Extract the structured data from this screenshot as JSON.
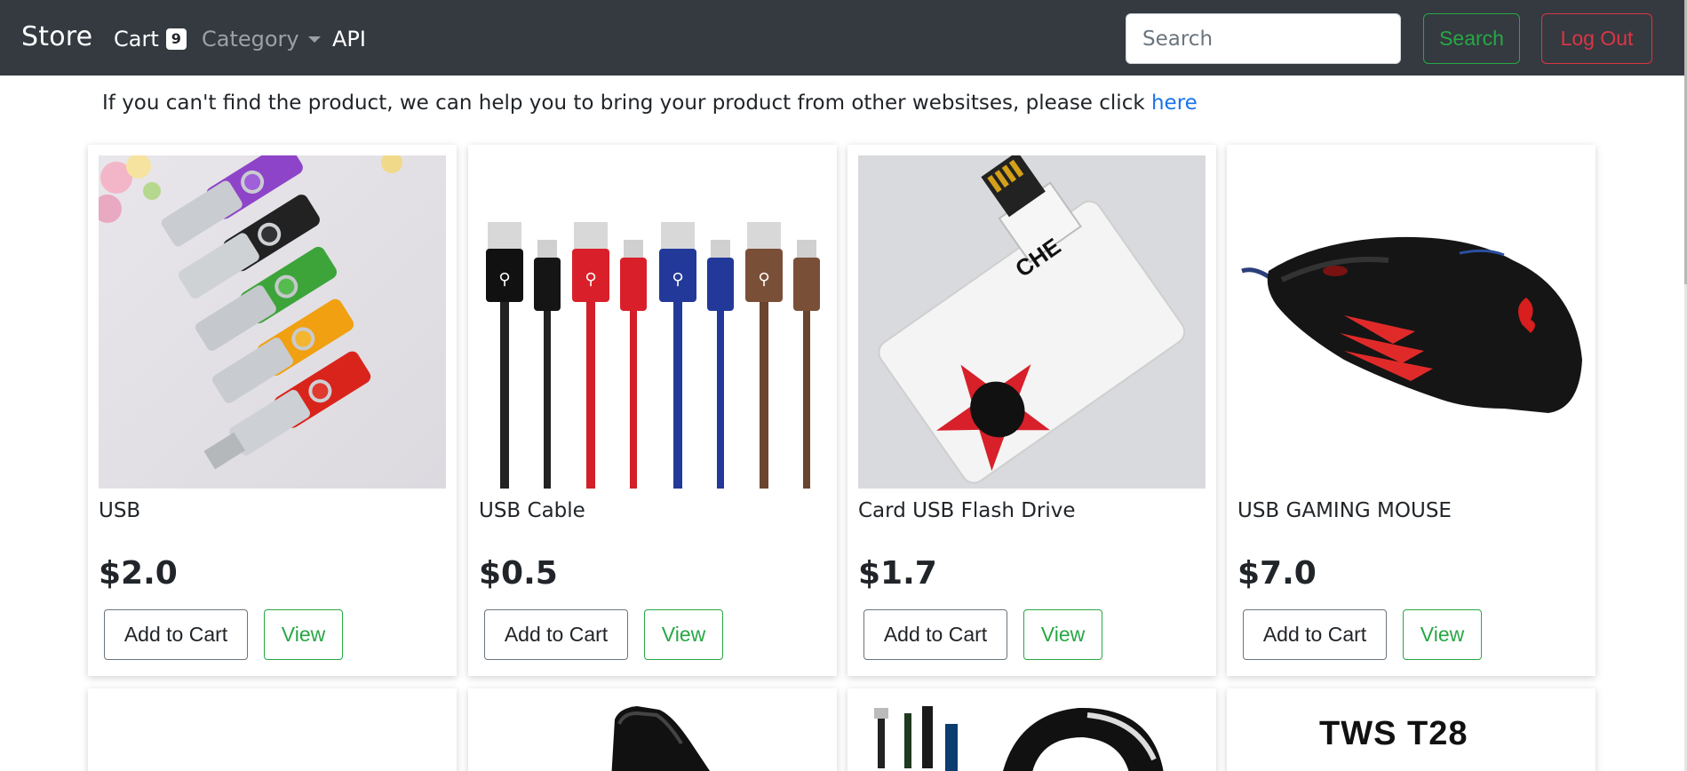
{
  "navbar": {
    "brand": "Store",
    "cart_label": "Cart",
    "cart_count": "9",
    "category_label": "Category",
    "api_label": "API",
    "search_placeholder": "Search",
    "search_button": "Search",
    "logout_button": "Log Out"
  },
  "notice": {
    "text": "If you can't find the product, we can help you to bring your product from other websitses, please click ",
    "link_text": "here"
  },
  "products": [
    {
      "title": "USB",
      "price": "$2.0",
      "add_label": "Add to Cart",
      "view_label": "View",
      "image": "usb-flash-drives-image"
    },
    {
      "title": "USB Cable",
      "price": "$0.5",
      "add_label": "Add to Cart",
      "view_label": "View",
      "image": "usb-cables-image"
    },
    {
      "title": "Card USB Flash Drive",
      "price": "$1.7",
      "add_label": "Add to Cart",
      "view_label": "View",
      "image": "card-flash-drive-image"
    },
    {
      "title": "USB GAMING MOUSE",
      "price": "$7.0",
      "add_label": "Add to Cart",
      "view_label": "View",
      "image": "gaming-mouse-image"
    }
  ],
  "second_row": {
    "product8_image_text": "TWS     T28"
  },
  "colors": {
    "navbar_bg": "#343a40",
    "success": "#28a745",
    "danger": "#dc3545",
    "link": "#1a73e8"
  }
}
